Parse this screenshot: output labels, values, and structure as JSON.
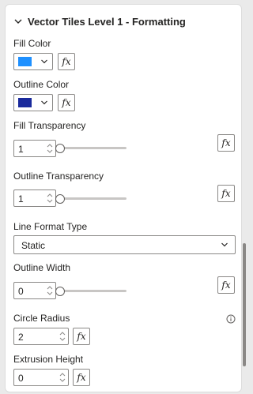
{
  "section": {
    "title": "Vector Tiles Level 1 - Formatting"
  },
  "fill_color": {
    "label": "Fill Color",
    "value": "#1e90ff"
  },
  "outline_color": {
    "label": "Outline Color",
    "value": "#1a2a9c"
  },
  "fill_transparency": {
    "label": "Fill Transparency",
    "value": "1",
    "slider_fraction": 0
  },
  "outline_transparency": {
    "label": "Outline Transparency",
    "value": "1",
    "slider_fraction": 0
  },
  "line_format_type": {
    "label": "Line Format Type",
    "value": "Static"
  },
  "outline_width": {
    "label": "Outline Width",
    "value": "0",
    "slider_fraction": 0
  },
  "circle_radius": {
    "label": "Circle Radius",
    "value": "2"
  },
  "extrusion_height": {
    "label": "Extrusion Height",
    "value": "0"
  },
  "fx": {
    "symbol": "fx"
  },
  "icons": {
    "collapse": "chevron-down-icon",
    "dropdown": "chevron-down-icon",
    "info": "info-icon"
  }
}
